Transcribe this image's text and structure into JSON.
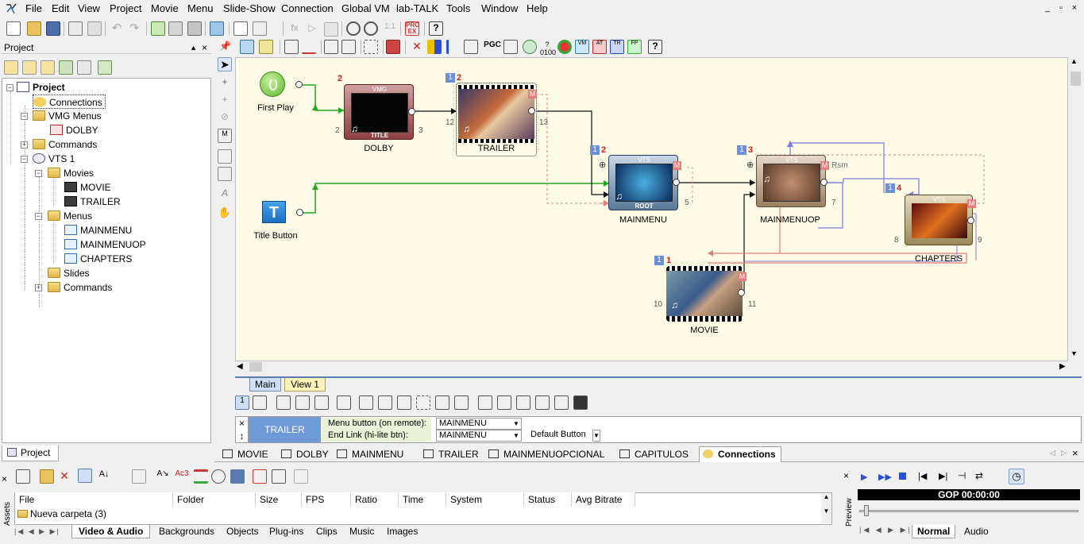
{
  "menubar": {
    "items": [
      "File",
      "Edit",
      "View",
      "Project",
      "Movie",
      "Menu",
      "Slide-Show",
      "Connection",
      "Global VM",
      "lab-TALK",
      "Tools",
      "Window",
      "Help"
    ],
    "window_controls": [
      "_",
      "▫",
      "×"
    ]
  },
  "project_panel": {
    "title": "Project",
    "tree": [
      {
        "label": "Project",
        "bold": true
      },
      {
        "label": "Connections"
      },
      {
        "label": "VMG Menus"
      },
      {
        "label": "DOLBY"
      },
      {
        "label": "Commands"
      },
      {
        "label": "VTS 1"
      },
      {
        "label": "Movies"
      },
      {
        "label": "MOVIE"
      },
      {
        "label": "TRAILER"
      },
      {
        "label": "Menus"
      },
      {
        "label": "MAINMENU"
      },
      {
        "label": "MAINMENUOP"
      },
      {
        "label": "CHAPTERS"
      },
      {
        "label": "Slides"
      },
      {
        "label": "Commands"
      }
    ],
    "bottom_tab": "Project"
  },
  "canvas": {
    "nodes": {
      "first_play": {
        "label": "First Play"
      },
      "title_button": {
        "label": "Title Button"
      },
      "dolby": {
        "label": "DOLBY",
        "header": "VMG",
        "footer": "TITLE",
        "top_num": "2",
        "left_num": "2",
        "right_num": "3"
      },
      "trailer": {
        "label": "TRAILER",
        "badge": "1",
        "top_num": "2",
        "left_num": "12",
        "right_num": "13",
        "m": "M"
      },
      "mainmenu": {
        "label": "MAINMENU",
        "header": "VTS",
        "footer": "ROOT",
        "badge": "1",
        "top_num": "2",
        "right_num": "5",
        "m": "M"
      },
      "mainmenuop": {
        "label": "MAINMENUOP",
        "header": "VTS",
        "badge": "1",
        "top_num": "3",
        "right_num": "7",
        "m": "M",
        "rsm": "Rsm"
      },
      "chapters": {
        "label": "CHAPTERS",
        "header": "VTS",
        "badge": "1",
        "top_num": "4",
        "left_num": "8",
        "right_num": "9",
        "m": "M"
      },
      "movie": {
        "label": "MOVIE",
        "badge": "1",
        "top_num": "1",
        "left_num": "10",
        "right_num": "11",
        "m": "M"
      }
    }
  },
  "view_tabs": [
    "Main",
    "View 1"
  ],
  "properties": {
    "selected": "TRAILER",
    "menu_button_label": "Menu button (on remote):",
    "menu_button_value": "MAINMENU",
    "end_link_label": "End Link (hi-lite btn):",
    "end_link_value": "MAINMENU",
    "default_button_value": "Default Button"
  },
  "doc_tabs": [
    "MOVIE",
    "DOLBY",
    "MAINMENU",
    "TRAILER",
    "MAINMENUOPCIONAL",
    "CAPITULOS",
    "Connections"
  ],
  "assets": {
    "columns": [
      "File",
      "Folder",
      "Size",
      "FPS",
      "Ratio",
      "Time",
      "System",
      "Status",
      "Avg Bitrate"
    ],
    "rows": [
      {
        "file": "Nueva carpeta (3)"
      }
    ],
    "side_label": "Assets",
    "bottom_tabs": [
      "Video & Audio",
      "Backgrounds",
      "Objects",
      "Plug-ins",
      "Clips",
      "Music",
      "Images"
    ]
  },
  "preview": {
    "side_label": "Preview",
    "timecode": "GOP 00:00:00",
    "tabs": [
      "Normal",
      "Audio"
    ]
  }
}
